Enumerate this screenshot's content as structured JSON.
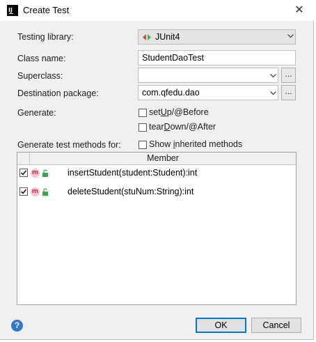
{
  "window": {
    "title": "Create Test",
    "app_icon_text": "IJ",
    "close_glyph": "✕"
  },
  "form": {
    "testing_library_label": "Testing library:",
    "testing_library_value": "JUnit4",
    "class_name_label": "Class name:",
    "class_name_value": "StudentDaoTest",
    "superclass_label": "Superclass:",
    "superclass_value": "",
    "destination_label": "Destination package:",
    "destination_value": "com.qfedu.dao",
    "browse_label": "...",
    "generate_label": "Generate:",
    "setup": {
      "pre": "set",
      "mnemonic": "U",
      "post": "p/@Before",
      "checked": false
    },
    "teardown": {
      "pre": "tear",
      "mnemonic": "D",
      "post": "own/@After",
      "checked": false
    },
    "methods_for_label": "Generate test methods for:",
    "inherited": {
      "pre": "Show ",
      "mnemonic": "i",
      "post": "nherited methods",
      "checked": false
    }
  },
  "table": {
    "header": "Member",
    "method_icon_letter": "m",
    "rows": [
      {
        "label": "insertStudent(student:Student):int",
        "checked": true
      },
      {
        "label": "deleteStudent(stuNum:String):int",
        "checked": true
      }
    ]
  },
  "footer": {
    "help_glyph": "?",
    "ok_label": "OK",
    "cancel_label": "Cancel"
  },
  "colors": {
    "accent": "#0078d7",
    "help": "#2f77c9",
    "method_icon": "#c53a5a",
    "lock_icon": "#3fa34d"
  }
}
